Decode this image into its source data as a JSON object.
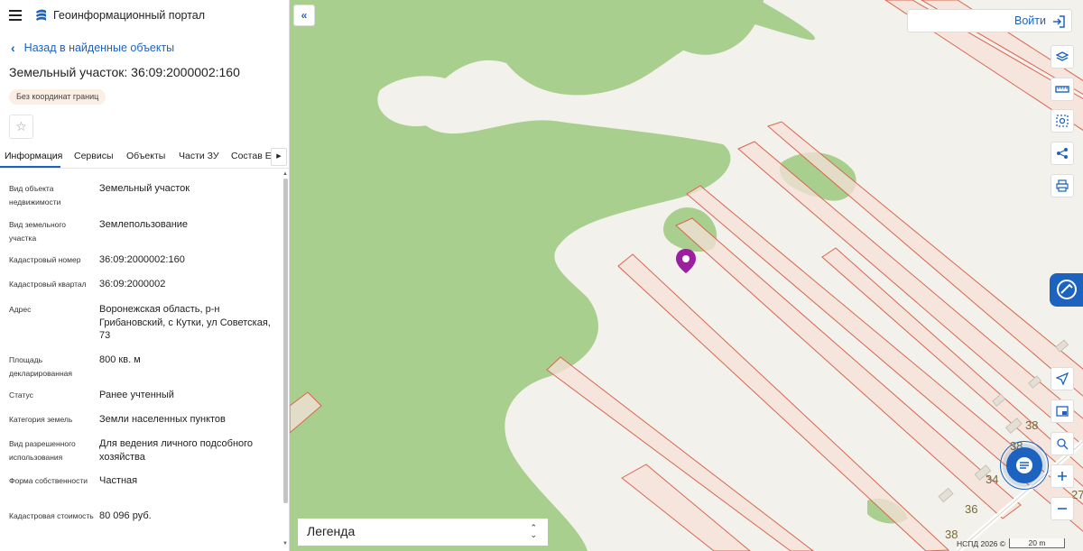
{
  "header": {
    "title": "Геоинформационный портал",
    "menu_icon": "menu-icon",
    "logo_icon": "portal-logo"
  },
  "sidebar": {
    "back_label": "Назад в найденные объекты",
    "parcel_title": "Земельный участок: 36:09:2000002:160",
    "badge": "Без координат границ",
    "tabs": [
      "Информация",
      "Сервисы",
      "Объекты",
      "Части ЗУ",
      "Состав ЕЗ"
    ],
    "active_tab": "Информация",
    "properties": [
      {
        "key": "Вид объекта недвижимости",
        "value": "Земельный участок"
      },
      {
        "key": "Вид земельного участка",
        "value": "Землепользование"
      },
      {
        "key": "Кадастровый номер",
        "value": "36:09:2000002:160"
      },
      {
        "key": "Кадастровый квартал",
        "value": "36:09:2000002"
      },
      {
        "key": "Адрес",
        "value": "Воронежская область, р-н Грибановский, с Кутки, ул Советская, 73"
      },
      {
        "key": "Площадь декларированная",
        "value": "800 кв. м"
      },
      {
        "key": "Статус",
        "value": "Ранее учтенный"
      },
      {
        "key": "Категория земель",
        "value": "Земли населенных пунктов"
      },
      {
        "key": "Вид разрешенного использования",
        "value": "Для ведения личного подсобного хозяйства"
      },
      {
        "key": "Форма собственности",
        "value": "Частная"
      },
      {
        "key": "Кадастровая стоимость",
        "value": "80 096 руб."
      }
    ]
  },
  "map": {
    "login_label": "Войти",
    "legend_label": "Легенда",
    "copyright": "НСПД 2026 ©",
    "scale_label": "20 m",
    "house_numbers": [
      "38",
      "38",
      "34",
      "36",
      "38",
      "27"
    ],
    "colors": {
      "forest": "#a9cf8e",
      "parcel_fill": "#f7e0d8",
      "parcel_stroke": "#d9654f",
      "marker": "#9b1f9e",
      "accent": "#1c63c0"
    }
  }
}
